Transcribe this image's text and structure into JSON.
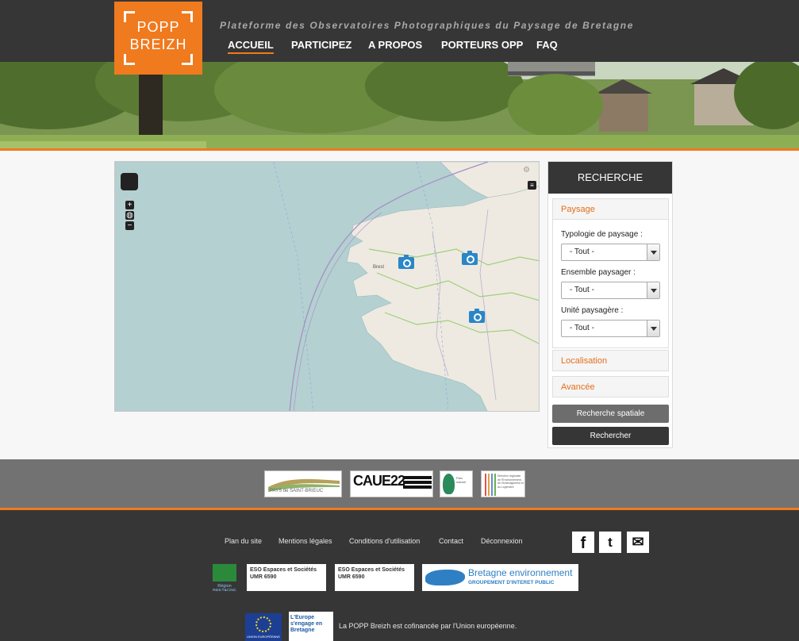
{
  "header": {
    "logo_line1": "POPP",
    "logo_line2": "BREIZH",
    "tagline": "Plateforme des Observatoires Photographiques du Paysage de Bretagne",
    "nav": [
      "ACCUEIL",
      "PARTICIPEZ",
      "A PROPOS",
      "PORTEURS OPP",
      "FAQ"
    ],
    "active_nav": "ACCUEIL"
  },
  "map": {
    "city_label": "Brest",
    "markers": 3
  },
  "search": {
    "title": "RECHERCHE",
    "section_paysage": "Paysage",
    "typologie_label": "Typologie de paysage :",
    "typologie_value": "- Tout -",
    "ensemble_label": "Ensemble paysager :",
    "ensemble_value": "- Tout -",
    "unite_label": "Unité paysagère :",
    "unite_value": "- Tout -",
    "section_localisation": "Localisation",
    "section_avancee": "Avancée",
    "spatial_button": "Recherche spatiale",
    "search_button": "Rechercher"
  },
  "partners": {
    "pays_saint_brieuc": "PAYS de SAINT-BRIEUC",
    "caue22": "CAUE22",
    "parc": "Parc naturel",
    "dreal": "Direction régionale de l'Environnement, de l'Aménagement et du Logement"
  },
  "footer": {
    "links": [
      "Plan du site",
      "Mentions légales",
      "Conditions d'utilisation",
      "Contact",
      "Déconnexion"
    ],
    "social": {
      "facebook": "f",
      "twitter": "t",
      "mail": "✉"
    },
    "region": "Région BRETAGNE",
    "eso": "ESO Espaces et Sociétés UMR 6590",
    "bretagne_env_line1": "Bretagne environnement",
    "bretagne_env_line2": "GROUPEMENT D'INTERET PUBLIC",
    "eu_label": "UNION EUROPÉENNE",
    "engage_label": "L'Europe s'engage en Bretagne",
    "cofinancement": "La POPP Breizh est cofinancée par l'Union européenne."
  },
  "colors": {
    "accent": "#f07a1e",
    "dark": "#363636",
    "marker": "#2a86c8",
    "sea": "#b4d0d1",
    "land": "#eeeae1"
  }
}
